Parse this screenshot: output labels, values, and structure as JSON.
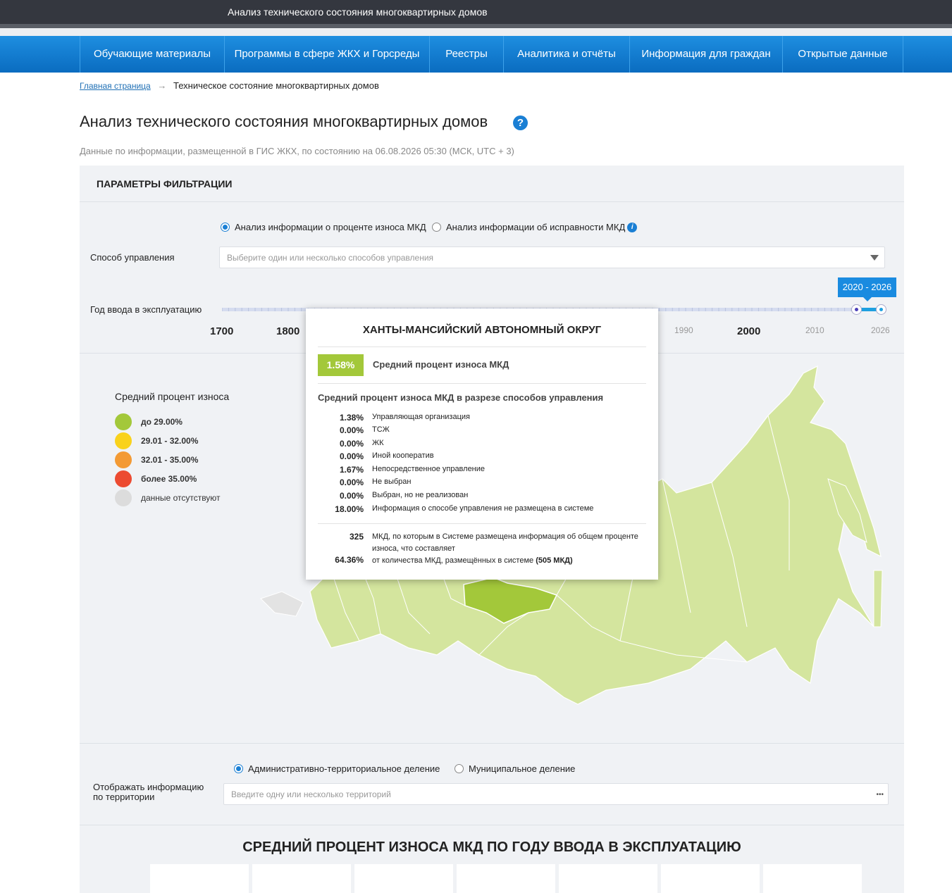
{
  "app": {
    "title": "Анализ технического состояния многоквартирных домов"
  },
  "nav": {
    "items": [
      "Обучающие материалы",
      "Программы в сфере ЖКХ и Горсреды",
      "Реестры",
      "Аналитика и отчёты",
      "Информация для граждан",
      "Открытые данные"
    ]
  },
  "breadcrumb": {
    "home": "Главная страница",
    "arrow": "→",
    "current": "Техническое состояние многоквартирных домов"
  },
  "page": {
    "title": "Анализ технического состояния многоквартирных домов",
    "help": "?",
    "subtitle": "Данные по информации, размещенной в ГИС ЖКХ, по состоянию на 06.08.2026 05:30 (МСК, UTC + 3)"
  },
  "filters": {
    "header": "ПАРАМЕТРЫ ФИЛЬТРАЦИИ",
    "radio1": "Анализ информации о проценте износа МКД",
    "radio2": "Анализ информации об исправности МКД",
    "radio_selected": 1,
    "management_label": "Способ управления",
    "management_placeholder": "Выберите один или несколько способов управления",
    "year_label": "Год ввода в эксплуатацию",
    "year_range": "2020 - 2026",
    "year_ticks_major": [
      "1700",
      "1800",
      "2000"
    ],
    "year_ticks_minor": [
      "1990",
      "2010",
      "2026"
    ]
  },
  "legend": {
    "title": "Средний процент износа",
    "items": [
      {
        "label": "до 29.00%",
        "color": "#a3c83a"
      },
      {
        "label": "29.01 - 32.00%",
        "color": "#f9d21c"
      },
      {
        "label": "32.01 - 35.00%",
        "color": "#f39a34"
      },
      {
        "label": "более 35.00%",
        "color": "#ec4b31"
      },
      {
        "label": "данные отсутствуют",
        "color": "#dcdcdc"
      }
    ]
  },
  "tooltip": {
    "title": "ХАНТЫ-МАНСИЙСКИЙ АВТОНОМНЫЙ ОКРУГ",
    "avg_value": "1.58%",
    "avg_label": "Средний процент износа МКД",
    "section": "Средний процент износа МКД в разрезе способов управления",
    "rows": [
      {
        "value": "1.38%",
        "name": "Управляющая организация"
      },
      {
        "value": "0.00%",
        "name": "ТСЖ"
      },
      {
        "value": "0.00%",
        "name": "ЖК"
      },
      {
        "value": "0.00%",
        "name": "Иной кооператив"
      },
      {
        "value": "1.67%",
        "name": "Непосредственное управление"
      },
      {
        "value": "0.00%",
        "name": "Не выбран"
      },
      {
        "value": "0.00%",
        "name": "Выбран, но не реализован"
      },
      {
        "value": "18.00%",
        "name": "Информация о способе управления не размещена в системе"
      }
    ],
    "count": "325",
    "count_text": "МКД, по которым в Системе размещена информация об общем проценте износа, что составляет",
    "percent": "64.36%",
    "percent_text": "от количества МКД, размещённых в системе",
    "total": "(505 МКД)"
  },
  "territory": {
    "radio1": "Административно-территориальное деление",
    "radio2": "Муниципальное деление",
    "label": "Отображать информацию по территории",
    "placeholder": "Введите одну или несколько территорий",
    "more": "•••"
  },
  "chart_section": {
    "title": "СРЕДНИЙ ПРОЦЕНТ ИЗНОСА МКД ПО ГОДУ ВВОДА В ЭКСПЛУАТАЦИЮ"
  },
  "colors": {
    "accent": "#1a7fd4",
    "nav": "#0a6cc0",
    "map_fill": "#d4e59e",
    "map_selected": "#a3c83a"
  }
}
